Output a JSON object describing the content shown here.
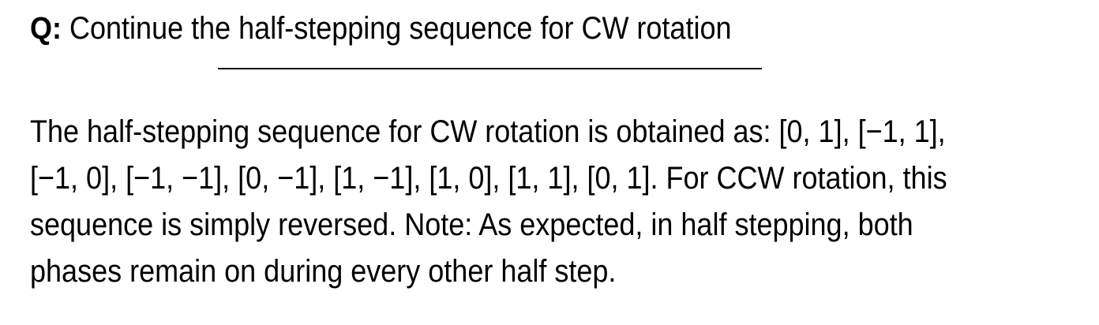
{
  "question": {
    "label": "Q:",
    "text": "Continue the half-stepping sequence for CW rotation"
  },
  "answer": {
    "lines": [
      "The half-stepping sequence for CW rotation is obtained as: [0, 1], [−1, 1],",
      "[−1, 0], [−1, −1], [0, −1], [1, −1], [1, 0], [1, 1], [0, 1]. For CCW rotation, this",
      "sequence is simply reversed. Note: As expected, in half stepping, both",
      "phases remain on during every other half step."
    ]
  }
}
